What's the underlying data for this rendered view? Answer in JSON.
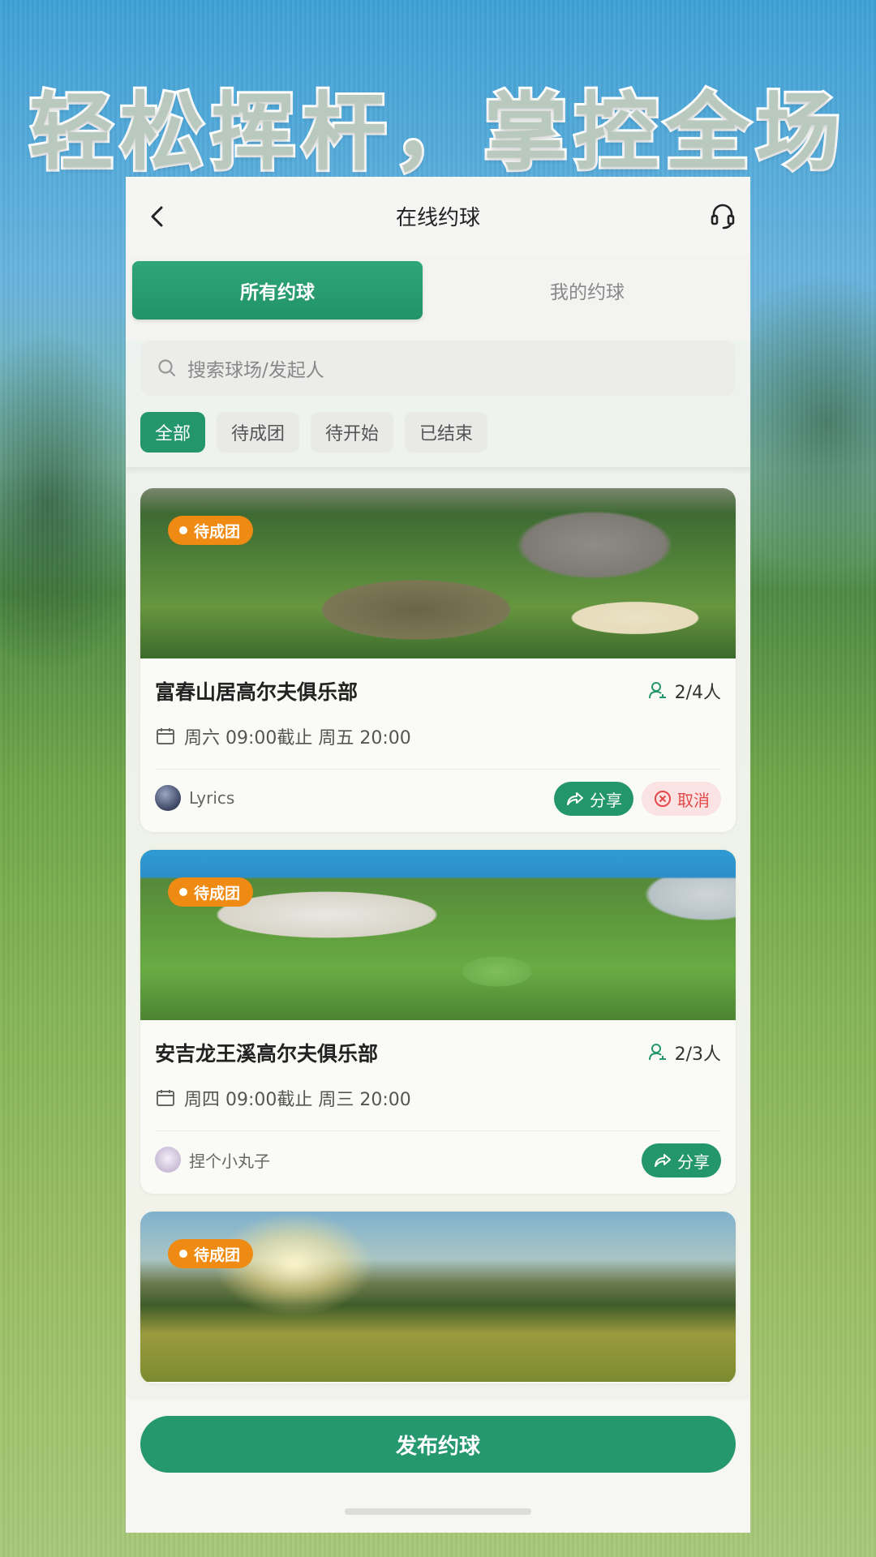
{
  "headline": "轻松挥杆，掌控全场",
  "nav": {
    "title": "在线约球"
  },
  "tabs": {
    "all": "所有约球",
    "mine": "我的约球"
  },
  "search": {
    "placeholder": "搜索球场/发起人"
  },
  "filters": [
    "全部",
    "待成团",
    "待开始",
    "已结束"
  ],
  "cards": [
    {
      "status": "待成团",
      "title": "富春山居高尔夫俱乐部",
      "count": "2/4人",
      "schedule": "周六 09:00截止 周五 20:00",
      "owner": "Lyrics",
      "share_label": "分享",
      "cancel_label": "取消"
    },
    {
      "status": "待成团",
      "title": "安吉龙王溪高尔夫俱乐部",
      "count": "2/3人",
      "schedule": "周四 09:00截止 周三 20:00",
      "owner": "捏个小丸子",
      "share_label": "分享"
    },
    {
      "status": "待成团"
    }
  ],
  "publish_label": "发布约球",
  "colors": {
    "primary": "#24966d",
    "badge": "#ef8a13",
    "cancel": "#e34747"
  },
  "icons": [
    "back-icon",
    "headset-icon",
    "search-icon",
    "people-icon",
    "calendar-icon",
    "share-icon",
    "cancel-icon"
  ]
}
